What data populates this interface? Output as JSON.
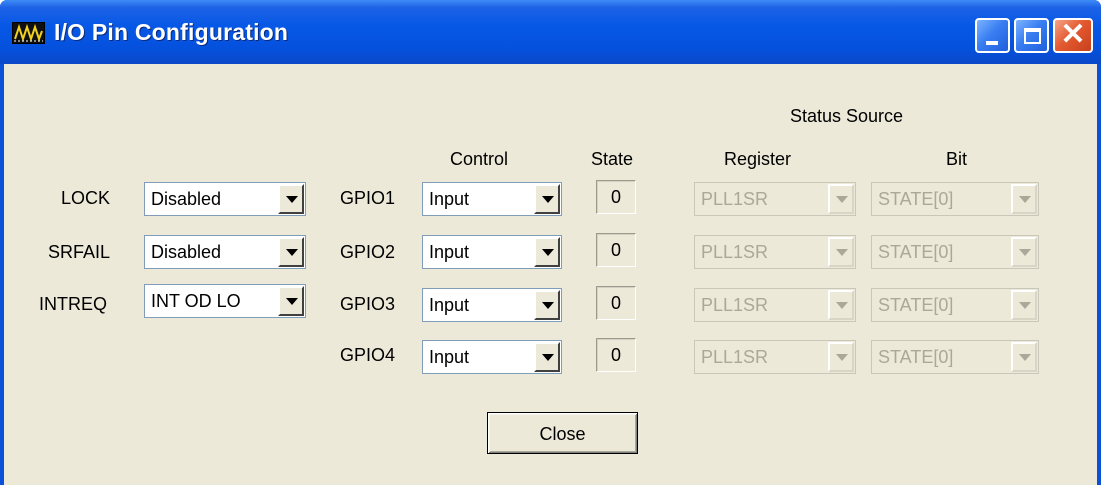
{
  "window": {
    "title": "I/O Pin Configuration",
    "icon": "waveform-app-icon",
    "controls": {
      "minimize": "minimize-icon",
      "maximize": "maximize-icon",
      "close": "close-icon",
      "close_glyph": "✕"
    }
  },
  "headers": {
    "status_source": "Status Source",
    "control": "Control",
    "state": "State",
    "register": "Register",
    "bit": "Bit"
  },
  "left_pins": [
    {
      "label": "LOCK",
      "value": "Disabled"
    },
    {
      "label": "SRFAIL",
      "value": "Disabled"
    },
    {
      "label": "INTREQ",
      "value": "INT OD LO"
    }
  ],
  "gpio": [
    {
      "label": "GPIO1",
      "control": "Input",
      "state": "0",
      "register": "PLL1SR",
      "bit": "STATE[0]"
    },
    {
      "label": "GPIO2",
      "control": "Input",
      "state": "0",
      "register": "PLL1SR",
      "bit": "STATE[0]"
    },
    {
      "label": "GPIO3",
      "control": "Input",
      "state": "0",
      "register": "PLL1SR",
      "bit": "STATE[0]"
    },
    {
      "label": "GPIO4",
      "control": "Input",
      "state": "0",
      "register": "PLL1SR",
      "bit": "STATE[0]"
    }
  ],
  "buttons": {
    "close": "Close"
  },
  "colors": {
    "titlebar": "#0758e6",
    "face": "#ece9d8",
    "disabled_text": "#aca899",
    "close_button": "#e45a31"
  }
}
